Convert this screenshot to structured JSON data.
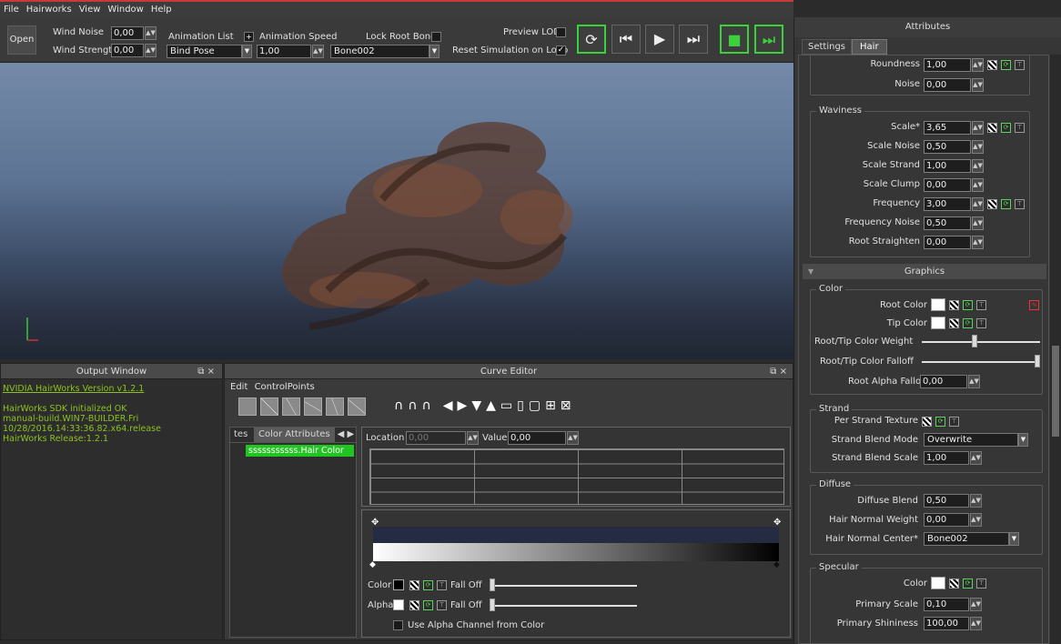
{
  "menu": [
    "File",
    "Hairworks",
    "View",
    "Window",
    "Help"
  ],
  "toolbar": {
    "open": "Open",
    "wind_noise_label": "Wind Noise",
    "wind_noise": "0,00",
    "wind_strength_label": "Wind Strength",
    "wind_strength": "0,00",
    "anim_list_label": "Animation List",
    "anim_list_value": "Bind Pose",
    "anim_speed_label": "Animation Speed",
    "anim_speed": "1,00",
    "lock_root_label": "Lock Root Bone",
    "bone": "Bone002",
    "preview_lod": "Preview LOD",
    "reset_sim": "Reset Simulation on Loop"
  },
  "output": {
    "title": "Output Window",
    "lines": [
      "NVIDIA HairWorks Version v1.2.1",
      "",
      "HairWorks SDK initialized OK",
      "manual-build.WIN7-BUILDER.Fri",
      "10/28/2016.14:33:36.82.x64.release",
      "HairWorks Release:1.2.1"
    ]
  },
  "curve": {
    "title": "Curve Editor",
    "menu": [
      "Edit",
      "ControlPoints"
    ],
    "tabs": [
      "tes",
      "Color Attributes"
    ],
    "selected_item": "sssssssssss.Hair Color",
    "location_label": "Location",
    "location_value": "0,00",
    "value_label": "Value",
    "value": "0,00",
    "color_label": "Color",
    "alpha_label": "Alpha",
    "falloff_label": "Fall Off",
    "use_alpha": "Use Alpha Channel from Color"
  },
  "attributes": {
    "title": "Attributes",
    "tabs": [
      "Settings",
      "Hair"
    ],
    "top_rows": [
      {
        "label": "Roundness",
        "value": "1,00"
      },
      {
        "label": "Noise",
        "value": "0,00"
      }
    ],
    "waviness": {
      "title": "Waviness",
      "rows": [
        {
          "label": "Scale*",
          "value": "3,65"
        },
        {
          "label": "Scale Noise",
          "value": "0,50"
        },
        {
          "label": "Scale Strand",
          "value": "1,00"
        },
        {
          "label": "Scale Clump",
          "value": "0,00"
        },
        {
          "label": "Frequency",
          "value": "3,00"
        },
        {
          "label": "Frequency Noise",
          "value": "0,50"
        },
        {
          "label": "Root Straighten",
          "value": "0,00"
        }
      ]
    },
    "graphics_title": "Graphics",
    "color": {
      "title": "Color",
      "root_color": "Root Color",
      "tip_color": "Tip Color",
      "weight": "Root/Tip Color Weight",
      "weight_value": 0.44,
      "falloff": "Root/Tip Color Falloff",
      "falloff_value": 1.0,
      "alpha_falloff": "Root Alpha Falloff",
      "alpha_falloff_value": "0,00"
    },
    "strand": {
      "title": "Strand",
      "texture": "Per Strand Texture",
      "blend_mode": "Strand Blend Mode",
      "blend_mode_value": "Overwrite",
      "blend_scale": "Strand Blend Scale",
      "blend_scale_value": "1,00"
    },
    "diffuse": {
      "title": "Diffuse",
      "rows": [
        {
          "label": "Diffuse Blend",
          "value": "0,50"
        },
        {
          "label": "Hair Normal Weight",
          "value": "0,00"
        }
      ],
      "normal_center": "Hair Normal Center*",
      "normal_center_value": "Bone002"
    },
    "specular": {
      "title": "Specular",
      "color": "Color",
      "rows": [
        {
          "label": "Primary Scale",
          "value": "0,10"
        },
        {
          "label": "Primary Shininess",
          "value": "100,00"
        }
      ]
    }
  }
}
